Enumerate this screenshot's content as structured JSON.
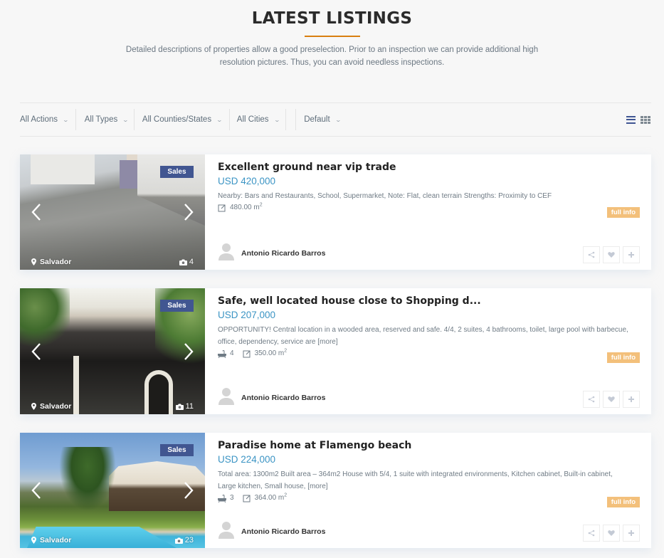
{
  "header": {
    "title": "LATEST LISTINGS",
    "description": "Detailed descriptions of properties allow a good preselection. Prior to an inspection we can provide additional high resolution pictures. Thus, you can avoid needless inspections."
  },
  "filters": {
    "actions": "All Actions",
    "types": "All Types",
    "counties": "All Counties/States",
    "cities": "All Cities",
    "sort": "Default"
  },
  "view_toggle": {
    "list_icon": "list-view-icon",
    "grid_icon": "grid-view-icon",
    "active": "list"
  },
  "colors": {
    "accent_underline": "#d97f10",
    "badge_bg": "#415691",
    "price": "#3b94c4",
    "full_info_bg": "#f3c07b"
  },
  "listings": [
    {
      "badge": "Sales",
      "location": "Salvador",
      "photo_count": "4",
      "title": "Excellent ground near vip trade",
      "price": "USD 420,000",
      "description": "Nearby: Bars and Restaurants, School, Supermarket, Note: Flat, clean terrain Strengths: Proximity to CEF",
      "more": "",
      "bathrooms": null,
      "area": "480.00 m",
      "area_unit_sup": "2",
      "full_info": "full info",
      "agent": "Antonio Ricardo Barros"
    },
    {
      "badge": "Sales",
      "location": "Salvador",
      "photo_count": "11",
      "title": "Safe, well located house close to Shopping d...",
      "price": "USD 207,000",
      "description": "OPPORTUNITY! Central location in a wooded area, reserved and safe. 4/4, 2 suites, 4 bathrooms, toilet, large pool with barbecue, office, dependency, service are ",
      "more": "[more]",
      "bathrooms": "4",
      "area": "350.00 m",
      "area_unit_sup": "2",
      "full_info": "full info",
      "agent": "Antonio Ricardo Barros"
    },
    {
      "badge": "Sales",
      "location": "Salvador",
      "photo_count": "23",
      "title": "Paradise home at Flamengo beach",
      "price": "USD 224,000",
      "description": "Total area: 1300m2 Built area – 364m2 House with 5/4, 1 suite with integrated environments, Kitchen cabinet, Built-in cabinet, Large kitchen, Small house, ",
      "more": "[more]",
      "bathrooms": "3",
      "area": "364.00 m",
      "area_unit_sup": "2",
      "full_info": "full info",
      "agent": "Antonio Ricardo Barros"
    }
  ]
}
